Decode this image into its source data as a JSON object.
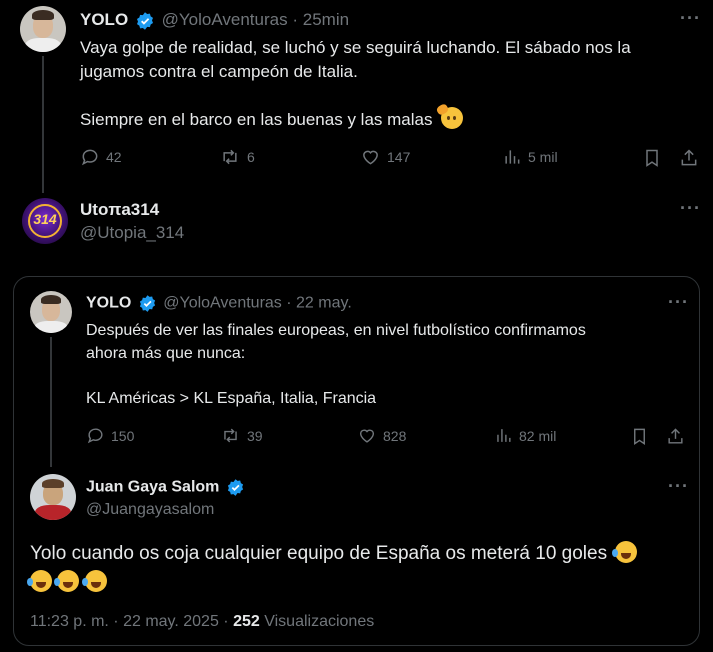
{
  "tweet1": {
    "name": "YOLO",
    "handle": "@YoloAventuras",
    "time": "25min",
    "line1": "Vaya golpe de realidad, se luchó y se seguirá luchando. El sábado nos la",
    "line2": "jugamos contra el campeón de Italia.",
    "line3": "Siempre en el barco en las buenas y las malas",
    "replies": "42",
    "retweets": "6",
    "likes": "147",
    "views": "5 mil"
  },
  "tweet2": {
    "name": "Utoπa314",
    "handle": "@Utopia_314",
    "avatar_text": "314"
  },
  "quoted": {
    "name": "YOLO",
    "handle": "@YoloAventuras",
    "time": "22 may.",
    "line1": "Después de ver las finales europeas, en nivel futbolístico confirmamos",
    "line2": "ahora más que nunca:",
    "line3": "KL Américas > KL España, Italia, Francia",
    "replies": "150",
    "retweets": "39",
    "likes": "828",
    "views": "82 mil"
  },
  "reply": {
    "name": "Juan Gaya Salom",
    "handle": "@Juangayasalom",
    "line1": "Yolo cuando os coja cualquier equipo de España os meterá 10 goles",
    "timestamp": "11:23 p. m. · 22 may. 2025 ·",
    "views_count": "252",
    "views_label": "Visualizaciones"
  },
  "separator": "·",
  "colors": {
    "verified": "#1d9bf0",
    "background": "#000000",
    "text": "#e7e9ea",
    "muted": "#71767b",
    "border": "#2f3336"
  },
  "icons": [
    "verified-badge-icon",
    "reply-icon",
    "retweet-icon",
    "like-icon",
    "views-icon",
    "bookmark-icon",
    "share-icon",
    "more-icon",
    "laughing-emoji-icon",
    "saluting-emoji-icon"
  ]
}
